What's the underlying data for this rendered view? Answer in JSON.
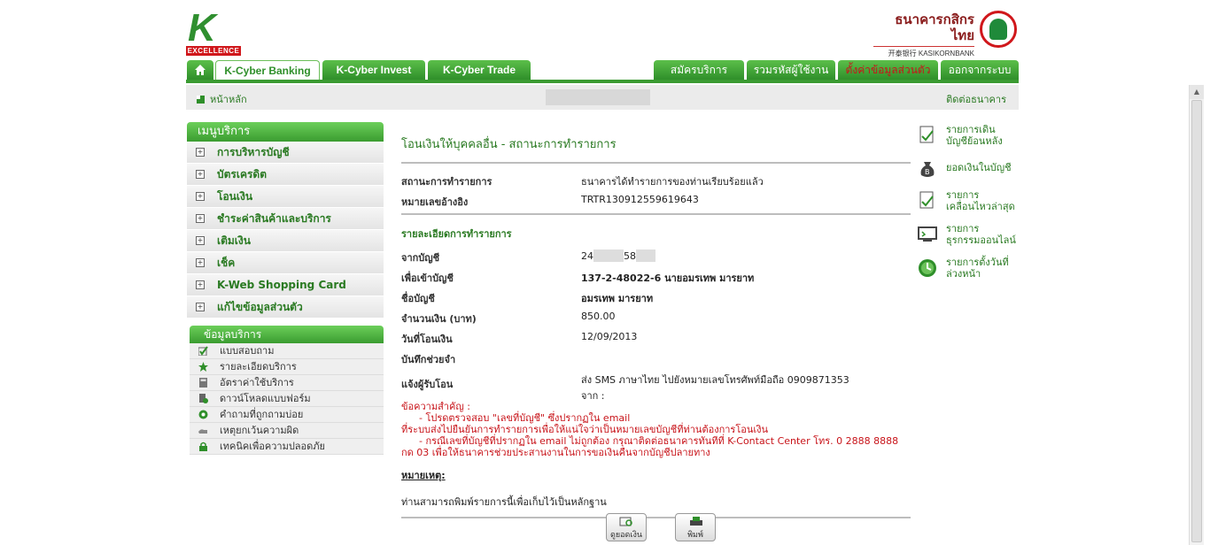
{
  "brand": {
    "logo_letter": "K",
    "logo_sub": "EXCELLENCE",
    "bank_thai": "ธนาคารกสิกรไทย",
    "bank_en": "开泰银行 KASIKORNBANK"
  },
  "tabs_left": [
    "K-Cyber Banking",
    "K-Cyber Invest",
    "K-Cyber Trade"
  ],
  "tabs_right": [
    "สมัครบริการ",
    "รวมรหัสผู้ใช้งาน",
    "ตั้งค่าข้อมูลส่วนตัว",
    "ออกจากระบบ"
  ],
  "subbar": {
    "home": "หน้าหลัก",
    "contact": "ติดต่อธนาคาร"
  },
  "menu": {
    "title": "เมนูบริการ",
    "items": [
      "การบริหารบัญชี",
      "บัตรเครดิต",
      "โอนเงิน",
      "ชำระค่าสินค้าและบริการ",
      "เติมเงิน",
      "เช็ค",
      "K-Web Shopping Card",
      "แก้ไขข้อมูลส่วนตัว"
    ]
  },
  "info": {
    "title": "ข้อมูลบริการ",
    "items": [
      "แบบสอบถาม",
      "รายละเอียดบริการ",
      "อัตราค่าใช้บริการ",
      "ดาวน์โหลดแบบฟอร์ม",
      "คำถามที่ถูกถามบ่อย",
      "เหตุยกเว้นความผิด",
      "เทคนิคเพื่อความปลอดภัย"
    ]
  },
  "content": {
    "title": "โอนเงินให้บุคคลอื่น - สถานะการทำรายการ",
    "status_label": "สถานะการทำรายการ",
    "status_value": "ธนาคารได้ทำรายการของท่านเรียบร้อยแล้ว",
    "ref_label": "หมายเลขอ้างอิง",
    "ref_value": "TRTR130912559619643",
    "section": "รายละเอียดการทำรายการ",
    "from_label": "จากบัญชี",
    "from_prefix": "24",
    "from_suffix": "58",
    "to_label": "เพื่อเข้าบัญชี",
    "to_value": "137-2-48022-6 นายอมรเทพ มารยาท",
    "name_label": "ชื่อบัญชี",
    "name_value": "อมรเทพ มารยาท",
    "amount_label": "จำนวนเงิน (บาท)",
    "amount_value": "850.00",
    "date_label": "วันที่โอนเงิน",
    "date_value": "12/09/2013",
    "memo_label": "บันทึกช่วยจำ",
    "notify_label": "แจ้งผู้รับโอน",
    "notify_value": "ส่ง SMS ภาษาไทย ไปยังหมายเลขโทรศัพท์มือถือ 0909871353",
    "notify_from": "จาก :",
    "warn_head": "ข้อความสำคัญ :",
    "warn_1": "- โปรดตรวจสอบ \"เลขที่บัญชี\" ซึ่งปรากฏใน email",
    "warn_2": "ที่ระบบส่งไปยืนยันการทำรายการเพื่อให้แน่ใจว่าเป็นหมายเลขบัญชีที่ท่านต้องการโอนเงิน",
    "warn_3": "- กรณีเลขที่บัญชีที่ปรากฏใน email ไม่ถูกต้อง กรุณาติดต่อธนาคารทันทีที่ K-Contact Center โทร. 0 2888 8888",
    "warn_4": "กด 03 เพื่อให้ธนาคารช่วยประสานงานในการขอเงินคืนจากบัญชีปลายทาง",
    "note_head": "หมายเหตุ:",
    "note_body": "ท่านสามารถพิมพ์รายการนี้เพื่อเก็บไว้เป็นหลักฐาน",
    "btn_view": "ดูยอดเงิน",
    "btn_print": "พิมพ์"
  },
  "side": [
    {
      "line1": "รายการเดิน",
      "line2": "บัญชีย้อนหลัง"
    },
    {
      "line1": "ยอดเงินในบัญชี",
      "line2": ""
    },
    {
      "line1": "รายการ",
      "line2": "เคลื่อนไหวล่าสุด"
    },
    {
      "line1": "รายการ",
      "line2": "ธุรกรรมออนไลน์"
    },
    {
      "line1": "รายการตั้งวันที่",
      "line2": "ล่วงหน้า"
    }
  ]
}
